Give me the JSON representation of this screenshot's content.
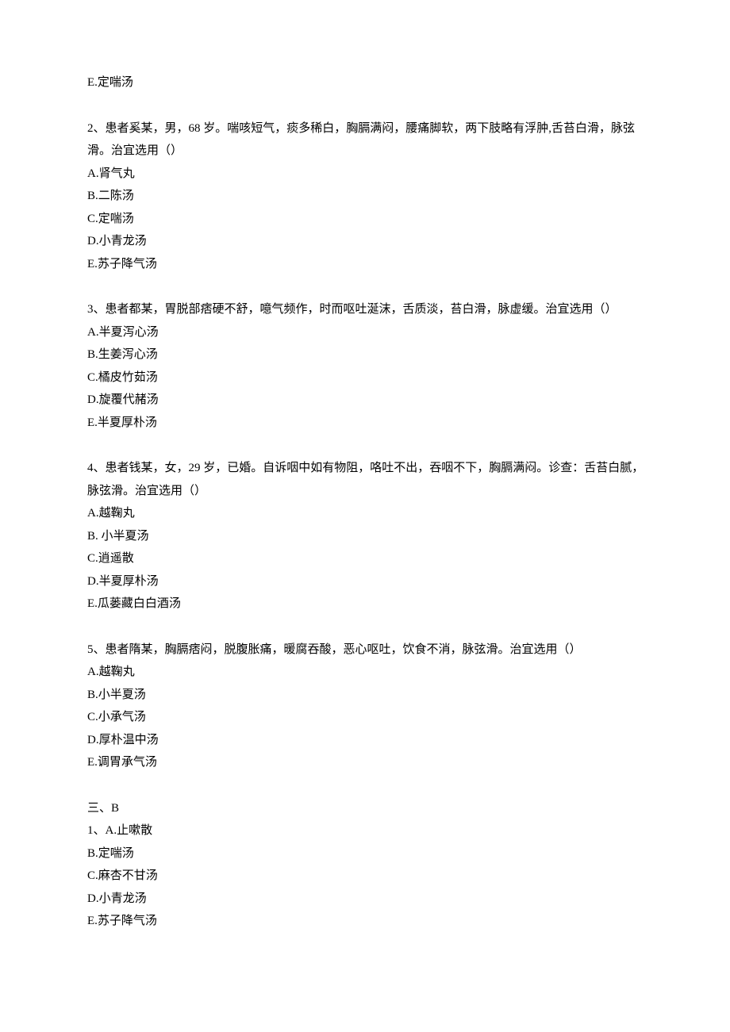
{
  "top_option": "E.定喘汤",
  "q2": {
    "stem": "2、患者奚某，男，68 岁。喘咳短气，痰多稀白，胸膈满闷，腰痛脚软，两下肢略有浮肿,舌苔白滑，脉弦滑。治宜选用（）",
    "A": "A.肾气丸",
    "B": "B.二陈汤",
    "C": "C.定喘汤",
    "D": "D.小青龙汤",
    "E": "E.苏子降气汤"
  },
  "q3": {
    "stem": "3、患者都某，胃脱部痞硬不舒，噫气频作，时而呕吐涎沫，舌质淡，苔白滑，脉虚缓。治宜选用（）",
    "A": "A.半夏泻心汤",
    "B": "B.生姜泻心汤",
    "C": "C.橘皮竹茹汤",
    "D": "D.旋覆代赭汤",
    "E": "E.半夏厚朴汤"
  },
  "q4": {
    "stem": "4、患者钱某，女，29 岁，已婚。自诉咽中如有物阻，咯吐不出，吞咽不下，胸膈满闷。诊查：舌苔白腻，脉弦滑。治宜选用（）",
    "A": "A.越鞠丸",
    "B": "B. 小半夏汤",
    "C": "C.逍遥散",
    "D": "D.半夏厚朴汤",
    "E": "E.瓜蒌藏白白酒汤"
  },
  "q5": {
    "stem": "5、患者隋某，胸膈痞闷，脱腹胀痛，暖腐吞酸，恶心呕吐，饮食不消，脉弦滑。治宜选用（）",
    "A": "A.越鞠丸",
    "B": "B.小半夏汤",
    "C": "C.小承气汤",
    "D": "D.厚朴温中汤",
    "E": "E.调胃承气汤"
  },
  "section3": {
    "label": "三、B",
    "q1": {
      "A": "1、A.止嗽散",
      "B": "B.定喘汤",
      "C": "C.麻杏不甘汤",
      "D": "D.小青龙汤",
      "E": "E.苏子降气汤"
    }
  }
}
